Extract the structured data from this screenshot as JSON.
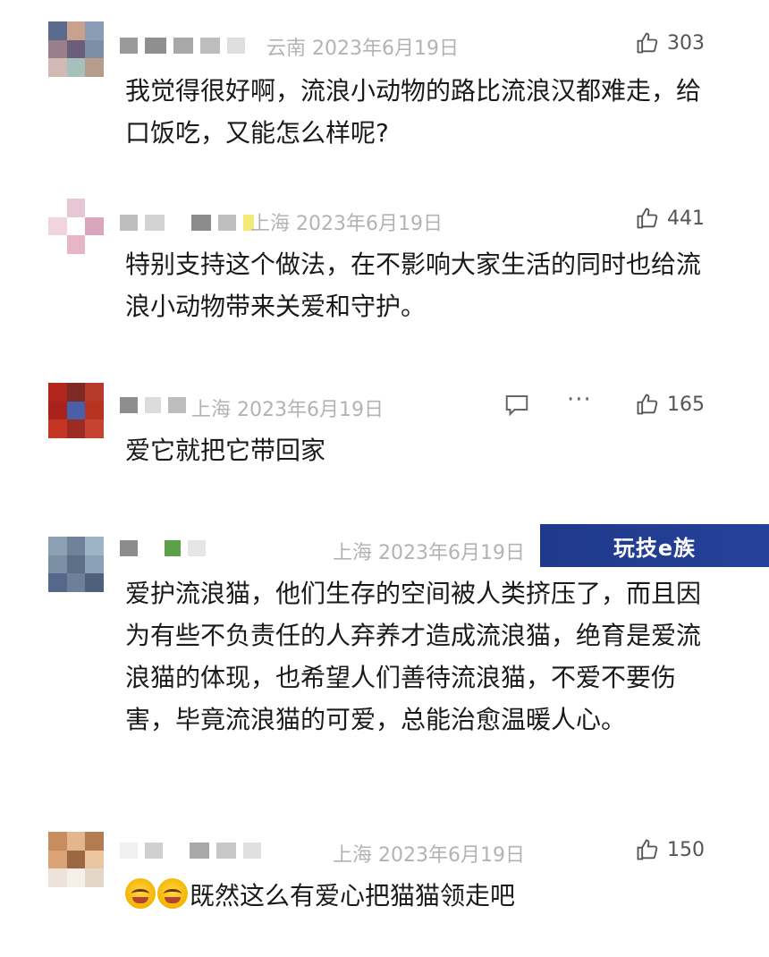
{
  "comments": [
    {
      "location_date": "云南 2023年6月19日",
      "likes": "303",
      "text": "我觉得很好啊，流浪小动物的路比流浪汉都难走，给口饭吃，又能怎么样呢?"
    },
    {
      "location_date": "上海 2023年6月19日",
      "likes": "441",
      "text": "特别支持这个做法，在不影响大家生活的同时也给流浪小动物带来关爱和守护。"
    },
    {
      "location_date": "上海 2023年6月19日",
      "likes": "165",
      "text": "爱它就把它带回家"
    },
    {
      "location_date": "上海 2023年6月19日",
      "likes": "",
      "text": "爱护流浪猫，他们生存的空间被人类挤压了，而且因为有些不负责任的人弃养才造成流浪猫，绝育是爱流浪猫的体现，也希望人们善待流浪猫，不爱不要伤害，毕竟流浪猫的可爱，总能治愈温暖人心。"
    },
    {
      "location_date": "上海 2023年6月19日",
      "likes": "150",
      "text": "既然这么有爱心把猫猫领走吧"
    }
  ],
  "watermark": "玩技e族",
  "icons": {
    "like": "thumbs-up-icon",
    "reply": "speech-bubble-icon",
    "more": "more-dots-icon",
    "emoji": "laughing-crying-emoji-icon"
  },
  "colors": {
    "meta": "#b3b3b3",
    "text": "#1a1a1a",
    "watermark_bg": "#1f3a8a"
  }
}
